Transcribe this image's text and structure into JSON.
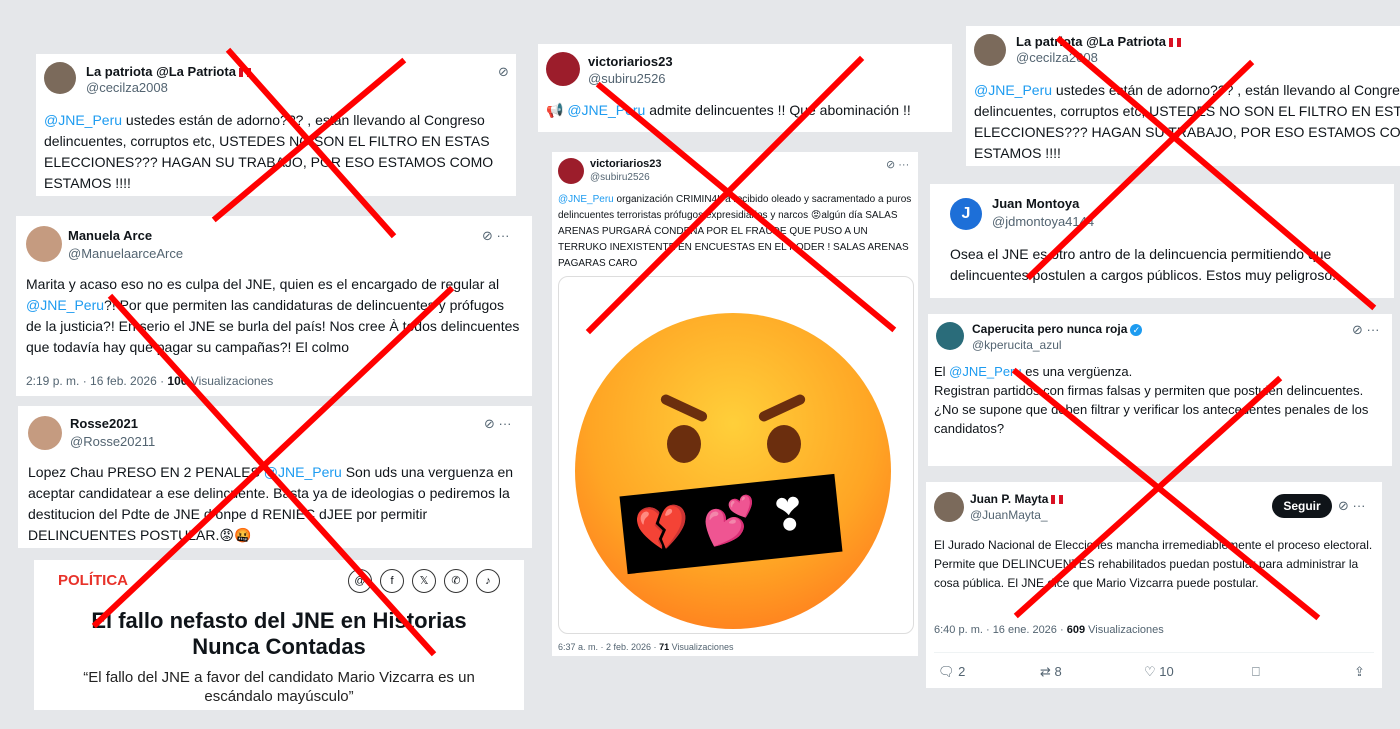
{
  "colors": {
    "background": "#e5e7ea",
    "link": "#1d9bf0",
    "cross": "#ff0000",
    "news_label": "#e8322a"
  },
  "tweet1": {
    "name": "La patriota @La Patriota",
    "handle": "@cecilza2008",
    "mention": "@JNE_Peru",
    "text": " ustedes están de adorno??? , están llevando al Congreso delincuentes, corruptos etc, USTEDES NO SON EL FILTRO EN ESTAS ELECCIONES???  HAGAN SU TRABAJO,  POR ESO ESTAMOS COMO ESTAMOS !!!!"
  },
  "tweet2": {
    "name": "Manuela Arce",
    "handle": "@ManuelaarceArce",
    "text_a": "Marita y acaso eso no es culpa del JNE, quien es el encargado de regular al ",
    "mention": "@JNE_Peru",
    "text_b": "?! Por que permiten las candidaturas de delincuentes y prófugos de la justicia?! En serio el JNE se burla del país! Nos cree À todos delincuentes que todavía hay que pagar su campañas?! El colmo",
    "date": "2:19 p. m. · 16 feb. 2026 · ",
    "views": "100",
    "views_label": " Visualizaciones"
  },
  "tweet3": {
    "name": "Rosse2021",
    "handle": "@Rosse20211",
    "text_a": "Lopez Chau PRESO EN 2 PENALES ",
    "mention": "@JNE_Peru",
    "text_b": " Son uds una verguenza en aceptar candidatear a ese delincuente. Basta ya de ideologias o pediremos la destitucion del Pdte de JNE d onpe d RENIEC dJEE por permitir DELINCUENTES POSTULAR.😡🤬"
  },
  "news": {
    "label": "POLÍTICA",
    "title": "El fallo nefasto del JNE en Historias Nunca Contadas",
    "subtitle": "“El fallo del JNE a favor del candidato Mario Vizcarra es un escándalo mayúsculo”",
    "share_icons": [
      "threads",
      "f",
      "x",
      "whatsapp",
      "tiktok"
    ]
  },
  "tweet4": {
    "name": "victoriarios23",
    "handle": "@subiru2526",
    "prefix": "📢 ",
    "mention": "@JNE_Peru",
    "text": " admite delincuentes !! Que abominación !!"
  },
  "tweet5": {
    "name": "victoriarios23",
    "handle": "@subiru2526",
    "mention": "@JNE_Peru",
    "text": " organización CRIMIN4L a recibido oleado y sacramentado a puros delincuentes terroristas prófugos expresidiarios y narcos 😡algún día SALAS ARENAS PURGARÁ CONDENA POR EL FRAUDE QUE PUSO A UN TERRUKO INEXISTENTE EN ENCUESTAS EN EL PODER ! SALAS ARENAS PAGARAS CARO",
    "date": "6:37 a. m. · 2 feb. 2026 · ",
    "views": "71",
    "views_label": " Visualizaciones"
  },
  "tweet6": {
    "name": "La patriota @La Patriota",
    "handle": "@cecilza2008",
    "mention": "@JNE_Peru",
    "text": " ustedes están de adorno??? , están llevando al Congreso delincuentes, corruptos etc, USTEDES NO SON EL FILTRO EN ESTAS ELECCIONES???  HAGAN SU TRABAJO,  POR ESO ESTAMOS COMO ESTAMOS !!!!"
  },
  "tweet7": {
    "name": "Juan Montoya",
    "handle": "@jdmontoya4144",
    "avatar_letter": "J",
    "text": "Osea el JNE es otro antro de la delincuencia permitiendo que delincuentes postulen a cargos públicos. Estos muy peligroso."
  },
  "tweet8": {
    "name": "Caperucita pero nunca roja",
    "handle": "@kperucita_azul",
    "text_a": "El ",
    "mention": "@JNE_Peru",
    "text_b": " es una vergüenza.\nRegistran partidos con firmas falsas y permiten que postulen delincuentes.\n¿No se supone que deben filtrar y verificar los antecedentes penales de los candidatos?"
  },
  "tweet9": {
    "name": "Juan P. Mayta",
    "handle": "@JuanMayta_",
    "follow": "Seguir",
    "text": "El Jurado Nacional de Elecciones mancha irremediablemente el proceso electoral. Permite que DELINCUENTES rehabilitados puedan postular para administrar la cosa pública. El JNE dice que Mario Vizcarra puede postular.",
    "date": "6:40 p. m. · 16 ene. 2026 · ",
    "views": "609",
    "views_label": " Visualizaciones",
    "replies": "2",
    "retweets": "8",
    "likes": "10"
  }
}
